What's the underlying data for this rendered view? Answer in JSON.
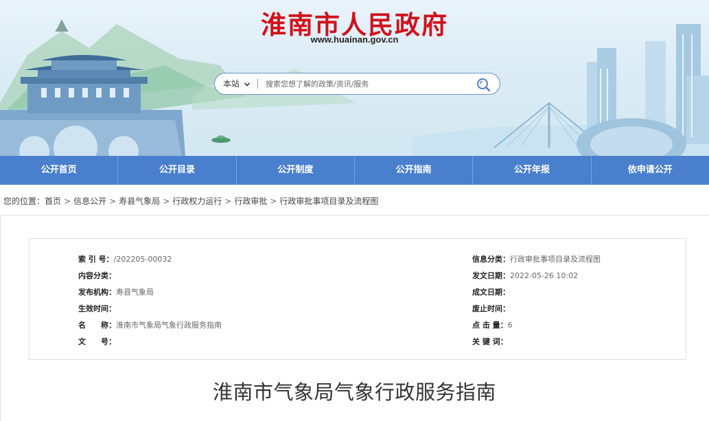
{
  "header": {
    "site_title": "淮南市人民政府",
    "site_url": "www.huainan.gov.cn"
  },
  "search": {
    "scope": "本站",
    "placeholder": "搜索您想了解的政策/资讯/服务"
  },
  "nav": {
    "items": [
      "公开首页",
      "公开目录",
      "公开制度",
      "公开指南",
      "公开年报",
      "依申请公开"
    ]
  },
  "breadcrumb": {
    "prefix": "您的位置：",
    "items": [
      "首页",
      "信息公开",
      "寿县气象局",
      "行政权力运行",
      "行政审批",
      "行政审批事项目录及流程图"
    ],
    "separator": ">"
  },
  "info": {
    "left": [
      {
        "label": "索 引 号：",
        "value": "/202205-00032"
      },
      {
        "label": "内容分类：",
        "value": ""
      },
      {
        "label": "发布机构：",
        "value": "寿县气象局"
      },
      {
        "label": "生效时间：",
        "value": ""
      },
      {
        "label": "名　　称：",
        "value": "淮南市气象局气象行政服务指南"
      },
      {
        "label": "文　　号：",
        "value": ""
      }
    ],
    "right": [
      {
        "label": "信息分类：",
        "value": "行政审批事项目录及流程图"
      },
      {
        "label": "发文日期：",
        "value": "2022-05-26 10:02"
      },
      {
        "label": "成文日期：",
        "value": ""
      },
      {
        "label": "废止时间：",
        "value": ""
      },
      {
        "label": "点 击 量：",
        "value": "6"
      },
      {
        "label": "关 键 词：",
        "value": ""
      }
    ]
  },
  "document": {
    "title": "淮南市气象局气象行政服务指南"
  },
  "colors": {
    "title_red": "#d1121b",
    "nav_blue": "#4a7fcd",
    "search_border": "#6c8fc8"
  }
}
